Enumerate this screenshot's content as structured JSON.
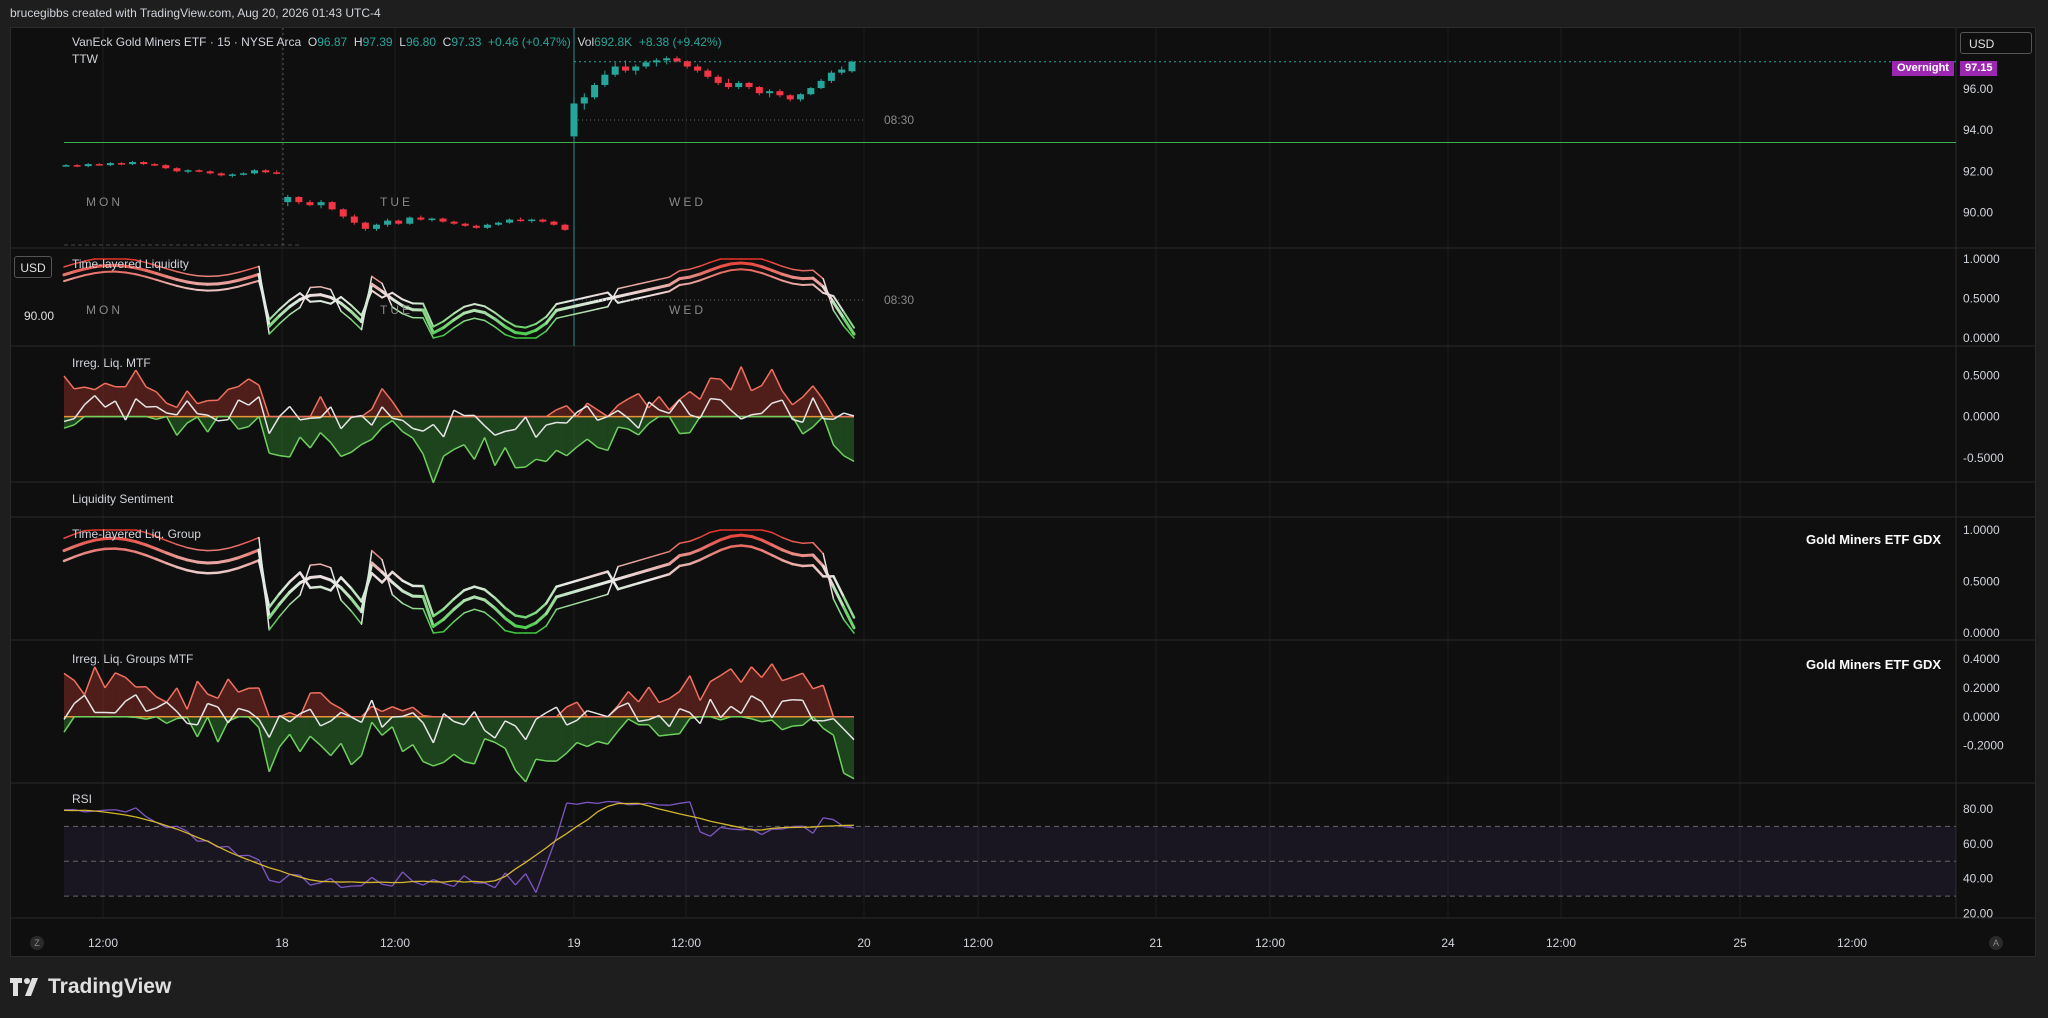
{
  "header": {
    "attribution": "brucegibbs created with TradingView.com, Aug 20, 2026 01:43 UTC-4"
  },
  "symbol": {
    "name": "VanEck Gold Miners ETF · 15 · NYSE Arca",
    "o_label": "O",
    "o": "96.87",
    "h_label": "H",
    "h": "97.39",
    "l_label": "L",
    "l": "96.80",
    "c_label": "C",
    "c": "97.33",
    "change": "+0.46 (+0.47%)",
    "vol_label": "Vol",
    "vol": "692.8K",
    "vol_change": "+8.38 (+9.42%)",
    "sub": "TTW"
  },
  "currency": "USD",
  "overnight": {
    "label": "Overnight",
    "price": "97.15"
  },
  "left_price": "90.00",
  "session_time": "08:30",
  "corner_left": "Z",
  "corner_right": "A",
  "brand": "TradingView",
  "colors": {
    "up": "#26a69a",
    "down": "#f23645",
    "green": "#4caf50",
    "red": "#e53935",
    "rsi": "#7e57c2",
    "rsi_ma": "#d4b72e",
    "bg": "#0f0f0f"
  },
  "chart_data": [
    {
      "type": "candlestick",
      "id": "price",
      "ticks": [
        "96.00",
        "94.00",
        "92.00",
        "90.00"
      ],
      "y_range": [
        88.9,
        98.0
      ],
      "day_labels": [
        "MON",
        "TUE",
        "WED"
      ],
      "hline": 93.4,
      "candles": [
        [
          92.3,
          92.35,
          92.25,
          92.3
        ],
        [
          92.3,
          92.35,
          92.2,
          92.25
        ],
        [
          92.25,
          92.4,
          92.2,
          92.35
        ],
        [
          92.35,
          92.4,
          92.3,
          92.3
        ],
        [
          92.3,
          92.45,
          92.25,
          92.4
        ],
        [
          92.4,
          92.45,
          92.3,
          92.35
        ],
        [
          92.35,
          92.5,
          92.3,
          92.45
        ],
        [
          92.45,
          92.5,
          92.3,
          92.35
        ],
        [
          92.35,
          92.4,
          92.25,
          92.3
        ],
        [
          92.3,
          92.35,
          92.1,
          92.15
        ],
        [
          92.15,
          92.2,
          91.95,
          92.0
        ],
        [
          92.0,
          92.1,
          91.9,
          92.05
        ],
        [
          92.05,
          92.1,
          91.95,
          92.0
        ],
        [
          92.0,
          92.05,
          91.85,
          91.9
        ],
        [
          91.9,
          91.95,
          91.75,
          91.8
        ],
        [
          91.8,
          91.9,
          91.7,
          91.85
        ],
        [
          91.85,
          91.95,
          91.8,
          91.9
        ],
        [
          91.9,
          92.1,
          91.85,
          92.05
        ],
        [
          92.05,
          92.1,
          91.9,
          91.95
        ],
        [
          91.95,
          92.05,
          91.85,
          91.9
        ],
        [
          90.5,
          90.85,
          90.3,
          90.75
        ],
        [
          90.75,
          90.8,
          90.4,
          90.5
        ],
        [
          90.5,
          90.6,
          90.3,
          90.35
        ],
        [
          90.35,
          90.6,
          90.2,
          90.5
        ],
        [
          90.5,
          90.55,
          90.1,
          90.15
        ],
        [
          90.15,
          90.2,
          89.7,
          89.8
        ],
        [
          89.8,
          89.9,
          89.4,
          89.5
        ],
        [
          89.5,
          89.55,
          89.1,
          89.2
        ],
        [
          89.2,
          89.45,
          89.1,
          89.4
        ],
        [
          89.4,
          89.7,
          89.3,
          89.6
        ],
        [
          89.6,
          89.65,
          89.4,
          89.45
        ],
        [
          89.45,
          89.8,
          89.4,
          89.75
        ],
        [
          89.75,
          89.85,
          89.6,
          89.65
        ],
        [
          89.65,
          89.75,
          89.55,
          89.7
        ],
        [
          89.7,
          89.75,
          89.5,
          89.55
        ],
        [
          89.55,
          89.6,
          89.4,
          89.45
        ],
        [
          89.45,
          89.5,
          89.3,
          89.35
        ],
        [
          89.35,
          89.4,
          89.2,
          89.25
        ],
        [
          89.25,
          89.45,
          89.2,
          89.4
        ],
        [
          89.4,
          89.55,
          89.35,
          89.5
        ],
        [
          89.5,
          89.7,
          89.45,
          89.65
        ],
        [
          89.65,
          89.75,
          89.55,
          89.6
        ],
        [
          89.6,
          89.7,
          89.5,
          89.65
        ],
        [
          89.65,
          89.7,
          89.5,
          89.55
        ],
        [
          89.55,
          89.6,
          89.35,
          89.4
        ],
        [
          89.4,
          89.45,
          89.1,
          89.15
        ],
        [
          93.7,
          95.6,
          93.6,
          95.3
        ],
        [
          95.3,
          95.8,
          95.0,
          95.6
        ],
        [
          95.6,
          96.3,
          95.5,
          96.2
        ],
        [
          96.2,
          96.9,
          96.1,
          96.7
        ],
        [
          96.7,
          97.3,
          96.6,
          97.1
        ],
        [
          97.1,
          97.4,
          96.8,
          96.9
        ],
        [
          96.9,
          97.2,
          96.7,
          97.1
        ],
        [
          97.1,
          97.4,
          97.0,
          97.3
        ],
        [
          97.3,
          97.5,
          97.1,
          97.4
        ],
        [
          97.4,
          97.6,
          97.2,
          97.5
        ],
        [
          97.5,
          97.6,
          97.3,
          97.35
        ],
        [
          97.35,
          97.4,
          97.0,
          97.1
        ],
        [
          97.1,
          97.2,
          96.8,
          96.9
        ],
        [
          96.9,
          97.0,
          96.5,
          96.6
        ],
        [
          96.6,
          96.7,
          96.2,
          96.3
        ],
        [
          96.3,
          96.5,
          96.0,
          96.1
        ],
        [
          96.1,
          96.4,
          96.0,
          96.3
        ],
        [
          96.3,
          96.35,
          96.0,
          96.1
        ],
        [
          96.1,
          96.15,
          95.7,
          95.8
        ],
        [
          95.8,
          96.0,
          95.6,
          95.9
        ],
        [
          95.9,
          96.0,
          95.6,
          95.7
        ],
        [
          95.7,
          95.75,
          95.4,
          95.5
        ],
        [
          95.5,
          95.8,
          95.4,
          95.75
        ],
        [
          95.75,
          96.1,
          95.7,
          96.05
        ],
        [
          96.05,
          96.5,
          96.0,
          96.4
        ],
        [
          96.4,
          96.9,
          96.3,
          96.8
        ],
        [
          96.8,
          97.1,
          96.7,
          96.95
        ],
        [
          96.87,
          97.39,
          96.8,
          97.33
        ]
      ]
    },
    {
      "type": "line",
      "id": "tll",
      "title": "Time-layered Liquidity",
      "ticks": [
        "1.0000",
        "0.5000",
        "0.0000"
      ],
      "y_range": [
        0,
        1
      ],
      "day_labels": [
        "MON",
        "TUE",
        "WED"
      ]
    },
    {
      "type": "area",
      "id": "ilm",
      "title": "Irreg. Liq. MTF",
      "ticks": [
        "0.5000",
        "0.0000",
        "-0.5000"
      ],
      "y_range": [
        -0.55,
        0.6
      ]
    },
    {
      "type": "label",
      "id": "ls",
      "title": "Liquidity Sentiment"
    },
    {
      "type": "line",
      "id": "tlg",
      "title": "Time-layered Liq. Group",
      "ticks": [
        "1.0000",
        "0.5000",
        "0.0000"
      ],
      "y_range": [
        0,
        1
      ],
      "annotation": "Gold Miners ETF GDX"
    },
    {
      "type": "area",
      "id": "ilg",
      "title": "Irreg. Liq. Groups MTF",
      "ticks": [
        "0.4000",
        "0.2000",
        "0.0000",
        "-0.2000"
      ],
      "y_range": [
        -0.3,
        0.45
      ],
      "annotation": "Gold Miners ETF GDX"
    },
    {
      "type": "line",
      "id": "rsi",
      "title": "RSI",
      "ticks": [
        "80.00",
        "60.00",
        "40.00",
        "20.00"
      ],
      "y_range": [
        18,
        88
      ],
      "bands": [
        30,
        50,
        70
      ]
    },
    {
      "type": "time_axis",
      "id": "xaxis",
      "labels": [
        "12:00",
        "18",
        "12:00",
        "19",
        "12:00",
        "20",
        "12:00",
        "21",
        "12:00",
        "24",
        "12:00",
        "25",
        "12:00"
      ]
    }
  ]
}
